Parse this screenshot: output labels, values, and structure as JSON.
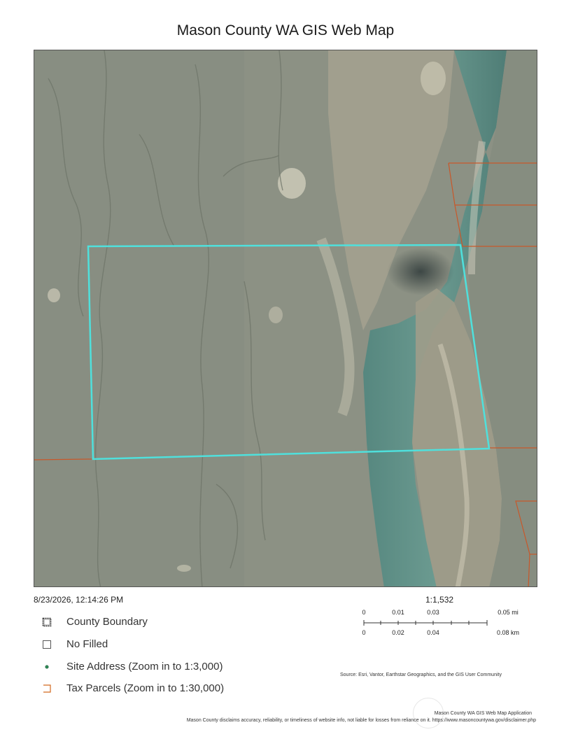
{
  "title": "Mason County WA GIS Web Map",
  "timestamp": "8/23/2026, 12:14:26 PM",
  "scale_ratio": "1:1,532",
  "scale_bar": {
    "top_labels": [
      "0",
      "0.01",
      "0.03",
      "0.05 mi"
    ],
    "bottom_labels": [
      "0",
      "0.02",
      "0.04",
      "0.08 km"
    ]
  },
  "legend": [
    {
      "label": "County Boundary",
      "icon": "county-boundary-icon",
      "color": "#333333"
    },
    {
      "label": "No Filled",
      "icon": "empty-square-icon",
      "color": "#555555"
    },
    {
      "label": "Site Address (Zoom in to 1:3,000)",
      "icon": "site-address-dot-icon",
      "color": "#2e8b57"
    },
    {
      "label": "Tax Parcels (Zoom in to 1:30,000)",
      "icon": "tax-parcel-icon",
      "color": "#d2691e"
    }
  ],
  "source_text": "Source: Esri, Vantor, Earthstar Geographics, and the GIS User Community",
  "footer_app": "Mason County WA GIS Web Map Application",
  "footer_disclaimer": "Mason County disclaims accuracy, reliability, or timeliness of website info, not liable for losses from reliance on it. https://www.masoncountywa.gov/disclaimer.php",
  "colors": {
    "selection_outline": "#4fe0dc",
    "parcel_lines": "#c8582a",
    "tideflat": "#8e9385",
    "channel": "#5c8c84",
    "sandbar": "#a6a493"
  }
}
